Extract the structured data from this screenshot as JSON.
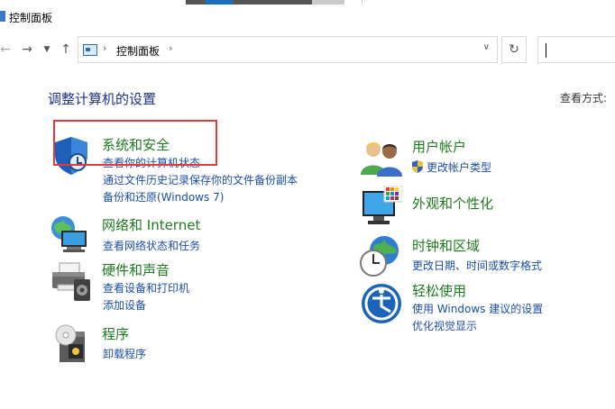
{
  "window": {
    "title": "控制面板"
  },
  "address_bar": {
    "crumb": "控制面板"
  },
  "main": {
    "heading": "调整计算机的设置",
    "view_by_label": "查看方式:"
  },
  "categories": {
    "system_security": {
      "title": "系统和安全",
      "links": [
        "查看你的计算机状态",
        "通过文件历史记录保存你的文件备份副本",
        "备份和还原(Windows 7)"
      ]
    },
    "network": {
      "title": "网络和 Internet",
      "links": [
        "查看网络状态和任务"
      ]
    },
    "hardware": {
      "title": "硬件和声音",
      "links": [
        "查看设备和打印机",
        "添加设备"
      ]
    },
    "programs": {
      "title": "程序",
      "links": [
        "卸载程序"
      ]
    },
    "user_accounts": {
      "title": "用户帐户",
      "links": [
        "更改帐户类型"
      ]
    },
    "appearance": {
      "title": "外观和个性化"
    },
    "clock_region": {
      "title": "时钟和区域",
      "links": [
        "更改日期、时间或数字格式"
      ]
    },
    "ease": {
      "title": "轻松使用",
      "links": [
        "使用 Windows 建议的设置",
        "优化视觉显示"
      ]
    }
  },
  "colors": {
    "category_title": "#1e7a1e",
    "link": "#1a4fa6",
    "heading": "#1e3287",
    "highlight": "#e23a3a"
  }
}
